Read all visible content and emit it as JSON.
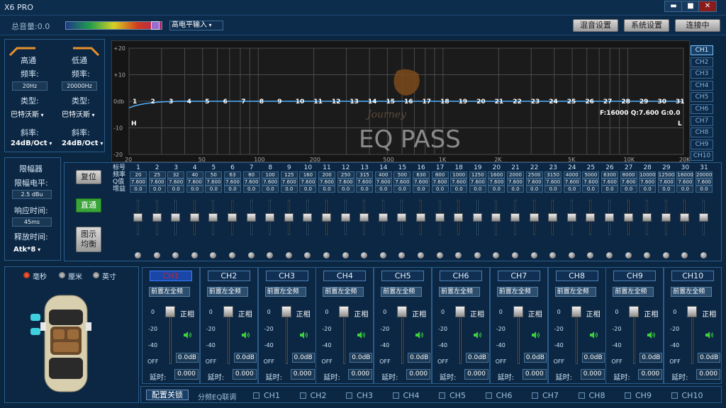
{
  "app": {
    "title": "X6 PRO"
  },
  "window_controls": [
    "▬",
    "■",
    "✕"
  ],
  "topbar": {
    "master_volume": "总音量:0.0",
    "input_mode": "高电平输入",
    "mix_button": "混音设置",
    "system_button": "系统设置",
    "connect_button": "连接中"
  },
  "crossover": {
    "hp": {
      "title": "高通",
      "freq_label": "频率:",
      "freq": "20Hz",
      "type_label": "类型:",
      "type": "巴特沃斯",
      "slope_label": "斜率:",
      "slope": "24dB/Oct"
    },
    "lp": {
      "title": "低通",
      "freq_label": "频率:",
      "freq": "20000Hz",
      "type_label": "类型:",
      "type": "巴特沃斯",
      "slope_label": "斜率:",
      "slope": "24dB/Oct"
    }
  },
  "limiter": {
    "title": "限幅器",
    "level_label": "限幅电平:",
    "level": "2.5 dBu",
    "response_label": "响应时间:",
    "response": "45ms",
    "release_label": "释放时间:",
    "release": "Atk*8"
  },
  "graph": {
    "y_labels": [
      "+20",
      "+10",
      "0db",
      "-10",
      "-20"
    ],
    "x_labels": [
      "20",
      "50",
      "100",
      "200",
      "500",
      "1K",
      "2K",
      "5K",
      "10K",
      "20K"
    ],
    "h_marker": "H",
    "l_marker": "L",
    "info": "F:16000 Q:7.600 G:0.0",
    "watermark": "EQ PASS",
    "logo_text": "Journey",
    "point_labels": [
      "1",
      "2",
      "3",
      "4",
      "5",
      "6",
      "7",
      "8",
      "9",
      "10",
      "11",
      "12",
      "13",
      "14",
      "15",
      "16",
      "17",
      "18",
      "19",
      "20",
      "21",
      "22",
      "23",
      "24",
      "25",
      "26",
      "27",
      "28",
      "29",
      "30",
      "31"
    ]
  },
  "graph_tabs": [
    "CH1",
    "CH2",
    "CH3",
    "CH4",
    "CH5",
    "CH6",
    "CH7",
    "CH8",
    "CH9",
    "CH10"
  ],
  "eq_buttons": {
    "reset": "复位",
    "bypass": "直通",
    "graphic": "图示\n均衡"
  },
  "eq_table": {
    "row_labels": [
      "标号",
      "频率",
      "Q值",
      "增益"
    ],
    "bands": [
      {
        "n": "1",
        "f": "20",
        "q": "7.600",
        "g": "0.0"
      },
      {
        "n": "2",
        "f": "25",
        "q": "7.600",
        "g": "0.0"
      },
      {
        "n": "3",
        "f": "32",
        "q": "7.600",
        "g": "0.0"
      },
      {
        "n": "4",
        "f": "40",
        "q": "7.600",
        "g": "0.0"
      },
      {
        "n": "5",
        "f": "50",
        "q": "7.600",
        "g": "0.0"
      },
      {
        "n": "6",
        "f": "63",
        "q": "7.600",
        "g": "0.0"
      },
      {
        "n": "7",
        "f": "80",
        "q": "7.600",
        "g": "0.0"
      },
      {
        "n": "8",
        "f": "100",
        "q": "7.600",
        "g": "0.0"
      },
      {
        "n": "9",
        "f": "125",
        "q": "7.600",
        "g": "0.0"
      },
      {
        "n": "10",
        "f": "160",
        "q": "7.600",
        "g": "0.0"
      },
      {
        "n": "11",
        "f": "200",
        "q": "7.600",
        "g": "0.0"
      },
      {
        "n": "12",
        "f": "250",
        "q": "7.600",
        "g": "0.0"
      },
      {
        "n": "13",
        "f": "315",
        "q": "7.600",
        "g": "0.0"
      },
      {
        "n": "14",
        "f": "400",
        "q": "7.600",
        "g": "0.0"
      },
      {
        "n": "15",
        "f": "500",
        "q": "7.600",
        "g": "0.0"
      },
      {
        "n": "16",
        "f": "630",
        "q": "7.600",
        "g": "0.0"
      },
      {
        "n": "17",
        "f": "800",
        "q": "7.600",
        "g": "0.0"
      },
      {
        "n": "18",
        "f": "1000",
        "q": "7.600",
        "g": "0.0"
      },
      {
        "n": "19",
        "f": "1250",
        "q": "7.600",
        "g": "0.0"
      },
      {
        "n": "20",
        "f": "1600",
        "q": "7.600",
        "g": "0.0"
      },
      {
        "n": "21",
        "f": "2000",
        "q": "7.600",
        "g": "0.0"
      },
      {
        "n": "22",
        "f": "2500",
        "q": "7.600",
        "g": "0.0"
      },
      {
        "n": "23",
        "f": "3150",
        "q": "7.600",
        "g": "0.0"
      },
      {
        "n": "24",
        "f": "4000",
        "q": "7.600",
        "g": "0.0"
      },
      {
        "n": "25",
        "f": "5000",
        "q": "7.600",
        "g": "0.0"
      },
      {
        "n": "26",
        "f": "6300",
        "q": "7.600",
        "g": "0.0"
      },
      {
        "n": "27",
        "f": "8000",
        "q": "7.600",
        "g": "0.0"
      },
      {
        "n": "28",
        "f": "10000",
        "q": "7.600",
        "g": "0.0"
      },
      {
        "n": "29",
        "f": "12500",
        "q": "7.600",
        "g": "0.0"
      },
      {
        "n": "30",
        "f": "16000",
        "q": "7.600",
        "g": "0.0"
      },
      {
        "n": "31",
        "f": "20000",
        "q": "7.600",
        "g": "0.0"
      }
    ]
  },
  "units": {
    "options": [
      "毫秒",
      "厘米",
      "英寸"
    ],
    "selected": "毫秒"
  },
  "channels": [
    {
      "name": "CH1",
      "source": "前置左全频",
      "phase": "正相",
      "gain": "0.0dB",
      "delay_label": "延时:",
      "delay": "0.000",
      "level": 1.0
    },
    {
      "name": "CH2",
      "source": "前置左全频",
      "phase": "正相",
      "gain": "0.0dB",
      "delay_label": "延时:",
      "delay": "0.000",
      "level": 1.0
    },
    {
      "name": "CH3",
      "source": "前置左全频",
      "phase": "正相",
      "gain": "0.0dB",
      "delay_label": "延时:",
      "delay": "0.000",
      "level": 1.0
    },
    {
      "name": "CH4",
      "source": "前置左全频",
      "phase": "正相",
      "gain": "0.0dB",
      "delay_label": "延时:",
      "delay": "0.000",
      "level": 1.0
    },
    {
      "name": "CH5",
      "source": "前置左全频",
      "phase": "正相",
      "gain": "0.0dB",
      "delay_label": "延时:",
      "delay": "0.000",
      "level": 1.0
    },
    {
      "name": "CH6",
      "source": "前置左全频",
      "phase": "正相",
      "gain": "0.0dB",
      "delay_label": "延时:",
      "delay": "0.000",
      "level": 1.0
    },
    {
      "name": "CH7",
      "source": "前置左全频",
      "phase": "正相",
      "gain": "0.0dB",
      "delay_label": "延时:",
      "delay": "0.000",
      "level": 1.0
    },
    {
      "name": "CH8",
      "source": "前置左全频",
      "phase": "正相",
      "gain": "0.0dB",
      "delay_label": "延时:",
      "delay": "0.000",
      "level": 1.0
    },
    {
      "name": "CH9",
      "source": "前置左全频",
      "phase": "正相",
      "gain": "0.0dB",
      "delay_label": "延时:",
      "delay": "0.000",
      "level": 1.0
    },
    {
      "name": "CH10",
      "source": "前置左全频",
      "phase": "正相",
      "gain": "0.0dB",
      "delay_label": "延时:",
      "delay": "0.000",
      "level": 1.0
    }
  ],
  "channel_scale": [
    "0",
    "-20",
    "-40",
    "OFF"
  ],
  "bottom": {
    "config_lock": "配置关锁",
    "eq_link_label": "分频EQ联调",
    "link_channels": [
      "CH1",
      "CH2",
      "CH3",
      "CH4",
      "CH5",
      "CH6",
      "CH7",
      "CH8",
      "CH9",
      "CH10"
    ]
  },
  "colors": {
    "accent": "#4fb0ff",
    "curve": "#4fb0ff",
    "bypass_green": "#3aa43a",
    "crossover_orange": "#e8902a"
  }
}
